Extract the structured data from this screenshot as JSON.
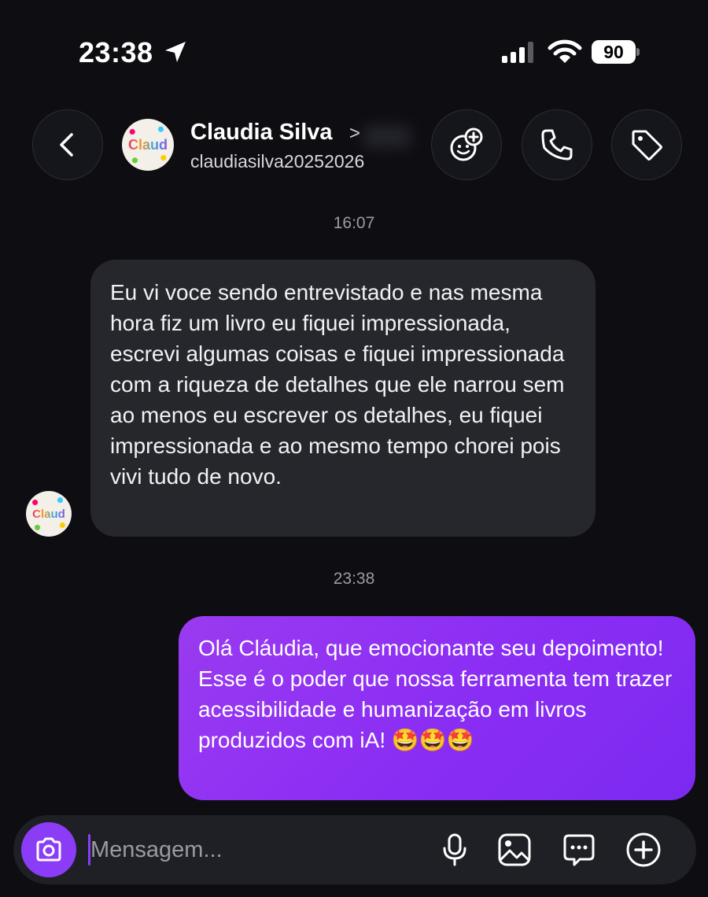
{
  "status_bar": {
    "time": "23:38",
    "battery": "90"
  },
  "header": {
    "name": "Claudia Silva",
    "chevron": ">",
    "handle": "claudiasilva20252026",
    "avatar_text": "Claud"
  },
  "messages": {
    "timestamp_1": "16:07",
    "incoming_text": "Eu vi voce sendo entrevistado e nas mesma hora fiz um livro eu fiquei impressionada, escrevi algumas coisas e fiquei impressionada com a riqueza de detalhes que ele narrou sem ao menos eu escrever os detalhes, eu fiquei impressionada e ao mesmo tempo chorei pois vivi tudo de novo.",
    "timestamp_2": "23:38",
    "outgoing_text": "Olá Cláudia, que emocionante seu depoimento! Esse é o poder que nossa ferramenta tem trazer acessibilidade e humanização em livros produzidos com iA! 🤩🤩🤩"
  },
  "composer": {
    "placeholder": "Mensagem..."
  },
  "colors": {
    "background": "#0d0d12",
    "incoming_bubble": "#26272d",
    "outgoing_bubble": "#8a2df4",
    "accent": "#8b3cf6"
  },
  "icons": [
    "location-arrow-icon",
    "signal-icon",
    "wifi-icon",
    "chevron-left-icon",
    "effects-icon",
    "phone-icon",
    "tag-icon",
    "camera-icon",
    "microphone-icon",
    "gallery-icon",
    "sticker-icon",
    "plus-icon"
  ]
}
